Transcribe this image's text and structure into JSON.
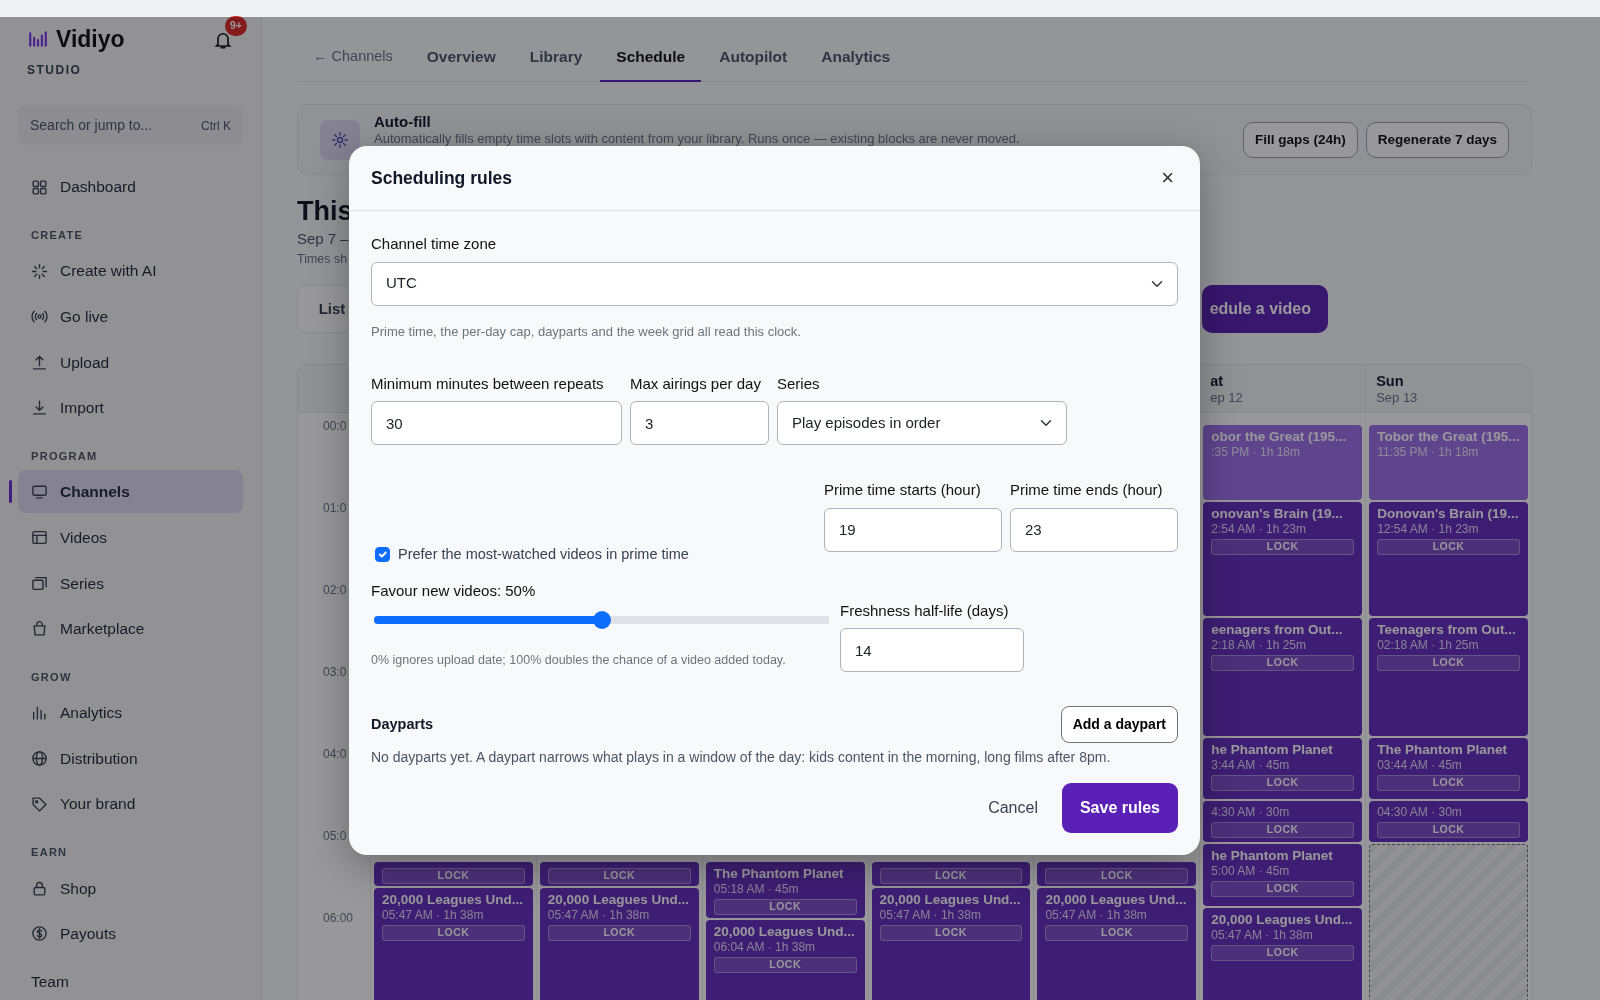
{
  "sidebar": {
    "logo": "Vidiyo",
    "subtitle": "STUDIO",
    "notification_badge": "9+",
    "search": {
      "placeholder": "Search or jump to...",
      "shortcut": "Ctrl K"
    },
    "sections": [
      {
        "items": [
          {
            "label": "Dashboard",
            "selected": false
          }
        ]
      },
      {
        "title": "CREATE",
        "items": [
          {
            "label": "Create with AI",
            "selected": false
          },
          {
            "label": "Go live",
            "selected": false
          },
          {
            "label": "Upload",
            "selected": false
          },
          {
            "label": "Import",
            "selected": false
          }
        ]
      },
      {
        "title": "PROGRAM",
        "items": [
          {
            "label": "Channels",
            "selected": true
          },
          {
            "label": "Videos",
            "selected": false
          },
          {
            "label": "Series",
            "selected": false
          },
          {
            "label": "Marketplace",
            "selected": false
          }
        ]
      },
      {
        "title": "GROW",
        "items": [
          {
            "label": "Analytics",
            "selected": false
          },
          {
            "label": "Distribution",
            "selected": false
          },
          {
            "label": "Your brand",
            "selected": false
          }
        ]
      },
      {
        "title": "EARN",
        "items": [
          {
            "label": "Shop",
            "selected": false
          },
          {
            "label": "Payouts",
            "selected": false
          }
        ]
      }
    ],
    "footer": "Team"
  },
  "tabs": [
    {
      "label": "← Channels",
      "kind": "back",
      "selected": false
    },
    {
      "label": "Overview",
      "kind": "tab",
      "selected": false
    },
    {
      "label": "Library",
      "kind": "tab",
      "selected": false
    },
    {
      "label": "Schedule",
      "kind": "tab",
      "selected": true
    },
    {
      "label": "Autopilot",
      "kind": "tab",
      "selected": false
    },
    {
      "label": "Analytics",
      "kind": "tab",
      "selected": false
    }
  ],
  "autofill": {
    "title": "Auto-fill",
    "description": "Automatically fills empty time slots with content from your library. Runs once — existing blocks are never moved.",
    "buttons": [
      "Fill gaps (24h)",
      "Regenerate 7 days"
    ]
  },
  "page": {
    "title": "This",
    "date_range": "Sep 7 –",
    "note": "Times sh",
    "view_toggle": "List",
    "schedule_button": "edule a video"
  },
  "calendar": {
    "hours": [
      "00:0",
      "01:0",
      "02:0",
      "03:0",
      "04:0",
      "05:0",
      "06:00"
    ],
    "days": [
      {
        "blocks": [
          {
            "kind": "scheduled",
            "lock": "LOCK"
          },
          {
            "kind": "scheduled",
            "title": "20,000 Leagues Und...",
            "time": "05:47 AM · 1h 38m",
            "lock": "LOCK"
          }
        ]
      },
      {
        "blocks": [
          {
            "kind": "scheduled",
            "lock": "LOCK"
          },
          {
            "kind": "scheduled",
            "title": "20,000 Leagues Und...",
            "time": "05:47 AM · 1h 38m",
            "lock": "LOCK"
          }
        ]
      },
      {
        "blocks": [
          {
            "kind": "scheduled",
            "title": "The Phantom Planet",
            "time": "05:18 AM · 45m",
            "lock": "LOCK"
          },
          {
            "kind": "scheduled",
            "title": "20,000 Leagues Und...",
            "time": "06:04 AM · 1h 38m",
            "lock": "LOCK"
          }
        ]
      },
      {
        "blocks": [
          {
            "kind": "scheduled",
            "lock": "LOCK"
          },
          {
            "kind": "scheduled",
            "title": "20,000 Leagues Und...",
            "time": "05:47 AM · 1h 38m",
            "lock": "LOCK"
          }
        ]
      },
      {
        "blocks": [
          {
            "kind": "scheduled",
            "lock": "LOCK"
          },
          {
            "kind": "scheduled",
            "title": "20,000 Leagues Und...",
            "time": "05:47 AM · 1h 38m",
            "lock": "LOCK"
          }
        ]
      },
      {
        "name": "at",
        "date": "ep 12",
        "blocks": [
          {
            "kind": "past",
            "title": "obor the Great (195...",
            "time": ":35 PM · 1h 18m"
          },
          {
            "kind": "scheduled",
            "title": "onovan's Brain (19...",
            "time": "2:54 AM · 1h 23m",
            "lock": "LOCK"
          },
          {
            "kind": "scheduled",
            "title": "eenagers from Out...",
            "time": "2:18 AM · 1h 25m",
            "lock": "LOCK"
          },
          {
            "kind": "scheduled",
            "title": "he Phantom Planet",
            "time": "3:44 AM · 45m",
            "lock": "LOCK"
          },
          {
            "kind": "scheduled",
            "time": "4:30 AM · 30m",
            "lock": "LOCK"
          },
          {
            "kind": "scheduled",
            "title": "he Phantom Planet",
            "time": "5:00 AM · 45m",
            "lock": "LOCK"
          },
          {
            "kind": "scheduled",
            "title": "20,000 Leagues Und...",
            "time": "05:47 AM · 1h 38m",
            "lock": "LOCK"
          }
        ]
      },
      {
        "name": "Sun",
        "date": "Sep 13",
        "blocks": [
          {
            "kind": "past",
            "title": "Tobor the Great (195...",
            "time": "11:35 PM · 1h 18m"
          },
          {
            "kind": "scheduled",
            "title": "Donovan's Brain (19...",
            "time": "12:54 AM · 1h 23m",
            "lock": "LOCK"
          },
          {
            "kind": "scheduled",
            "title": "Teenagers from Out...",
            "time": "02:18 AM · 1h 25m",
            "lock": "LOCK"
          },
          {
            "kind": "scheduled",
            "title": "The Phantom Planet",
            "time": "03:44 AM · 45m",
            "lock": "LOCK"
          },
          {
            "kind": "scheduled",
            "time": "04:30 AM · 30m",
            "lock": "LOCK"
          },
          {
            "kind": "empty"
          }
        ]
      }
    ]
  },
  "modal": {
    "title": "Scheduling rules",
    "close": "×",
    "timezone": {
      "label": "Channel time zone",
      "value": "UTC",
      "help": "Prime time, the per-day cap, dayparts and the week grid all read this clock."
    },
    "min_repeat": {
      "label": "Minimum minutes between repeats",
      "value": "30"
    },
    "max_airings": {
      "label": "Max airings per day",
      "value": "3"
    },
    "series": {
      "label": "Series",
      "value": "Play episodes in order"
    },
    "prefer_popular": {
      "label": "Prefer the most-watched videos in prime time",
      "checked": true
    },
    "prime_start": {
      "label": "Prime time starts (hour)",
      "value": "19"
    },
    "prime_end": {
      "label": "Prime time ends (hour)",
      "value": "23"
    },
    "favour_new": {
      "label": "Favour new videos: 50%",
      "level": 0.5,
      "help": "0% ignores upload date; 100% doubles the chance of a video added today."
    },
    "half_life": {
      "label": "Freshness half-life (days)",
      "value": "14"
    },
    "dayparts": {
      "title": "Dayparts",
      "button": "Add a daypart",
      "empty": "No dayparts yet. A daypart narrows what plays in a window of the day: kids content in the morning, long films after 8pm."
    },
    "buttons": {
      "cancel": "Cancel",
      "save": "Save rules"
    }
  }
}
